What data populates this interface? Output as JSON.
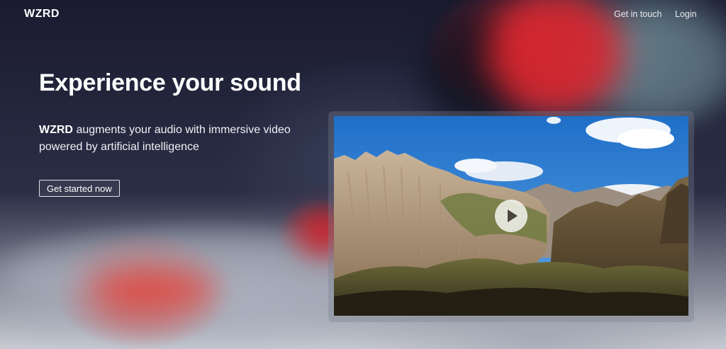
{
  "brand": {
    "logo": "WZRD"
  },
  "nav": {
    "contact_label": "Get in touch",
    "login_label": "Login"
  },
  "hero": {
    "title": "Experience your sound",
    "brand_word": "WZRD",
    "description": "augments your audio with immersive video powered by artificial intelligence",
    "cta_label": "Get started now"
  },
  "video": {
    "play_icon": "play-icon",
    "thumbnail_subject": "mountain landscape"
  },
  "colors": {
    "sky": "#2f7fd3",
    "accent_red": "#d7262f",
    "text": "#ffffff"
  }
}
